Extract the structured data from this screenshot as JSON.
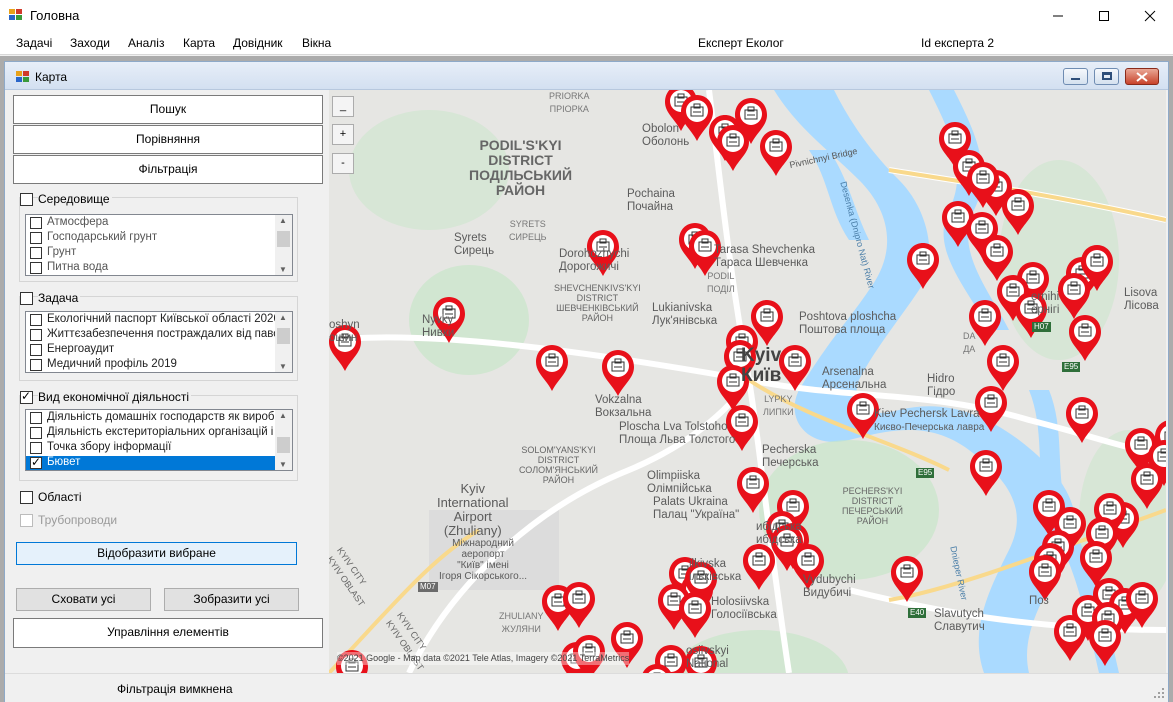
{
  "window": {
    "title": "Головна"
  },
  "menu": {
    "items": [
      "Задачі",
      "Заходи",
      "Аналіз",
      "Карта",
      "Довідник",
      "Вікна"
    ],
    "role_label": "Експерт Еколог",
    "expert_id_label": "Id експерта 2"
  },
  "child_window": {
    "title": "Карта"
  },
  "sidebar": {
    "buttons": {
      "search": "Пошук",
      "compare": "Порівняння",
      "filter": "Фільтрація"
    },
    "groups": [
      {
        "label": "Середовище",
        "checked": false,
        "items": [
          {
            "label": "Атмосфера",
            "checked": false
          },
          {
            "label": "Господарський грунт",
            "checked": false
          },
          {
            "label": "Грунт",
            "checked": false
          },
          {
            "label": "Питна вода",
            "checked": false
          }
        ]
      },
      {
        "label": "Задача",
        "checked": false,
        "items": [
          {
            "label": "Екологічний паспорт Київської області 2020",
            "checked": false
          },
          {
            "label": "Життєзабезпечення постраждалих від паводків",
            "checked": false
          },
          {
            "label": "Енергоаудит",
            "checked": false
          },
          {
            "label": "Медичний профіль 2019",
            "checked": false
          }
        ]
      },
      {
        "label": "Вид економічної діяльності",
        "checked": true,
        "items": [
          {
            "label": "Діяльність домашніх господарств як виробників",
            "checked": false
          },
          {
            "label": "Діяльність екстериторіальних організацій і органів",
            "checked": false
          },
          {
            "label": "Точка збору інформації",
            "checked": false
          },
          {
            "label": "Бювет",
            "checked": true,
            "selected": true
          }
        ]
      }
    ],
    "regions": {
      "label": "Області",
      "checked": false
    },
    "pipelines": {
      "label": "Трубопроводи",
      "checked": false,
      "disabled": true
    },
    "show_selected": "Відобразити вибране",
    "hide_all": "Сховати усі",
    "show_all": "Зобразити усі",
    "manage": "Управління елементів"
  },
  "map": {
    "zoom_buttons": [
      "_",
      "+",
      "-"
    ],
    "labels": {
      "obolon": "Obolon",
      "obolon_ua": "Оболонь",
      "priorka": "PRIORKA",
      "priorka_ua": "ПРІОРКА",
      "podilskyi_1": "PODIL'S'KYI",
      "podilskyi_2": "DISTRICT",
      "podilskyi_3": "ПОДІЛЬСЬКИЙ",
      "podilskyi_4": "РАЙОН",
      "pivnichnyi": "Pivnichnyi Bridge",
      "pochaina": "Pochaina",
      "pochaina_ua": "Почайна",
      "syrets_district_1": "SYRETS",
      "syrets_district_2": "СИРЕЦЬ",
      "syrets": "Syrets",
      "syrets_ua": "Сирець",
      "dorohozhychi": "Dorohozhychi",
      "dorohozhychi_ua": "Дорогожичі",
      "tarasa": "Tarasa Shevchenka",
      "tarasa_ua": "Тараса Шевченка",
      "podil": "PODIL",
      "podil_ua": "ПОДІЛ",
      "shevchenk_1": "SHEVCHENKIVS'KYI",
      "shevchenk_2": "DISTRICT",
      "shevchenk_3": "ШЕВЧЕНКІВСЬКИЙ",
      "shevchenk_4": "РАЙОН",
      "nyvky": "Nyvky",
      "nyvky_ua": "Нивки",
      "shyn": "oshyn",
      "shyn_ua": "ошин",
      "lukianivska": "Lukianivska",
      "lukianivska_ua": "Лук'янівська",
      "poshtova": "Poshtova ploshcha",
      "poshtova_ua": "Поштова площа",
      "kyiv": "Kyiv",
      "kyiv_ua": "Київ",
      "arsenalna": "Arsenalna",
      "arsenalna_ua": "Арсенальна",
      "hidro": "Hidro",
      "hidro_ua": "Гідро",
      "lypky": "LYPKY",
      "lypky_ua": "ЛИПКИ",
      "vokzalna": "Vokzalna",
      "vokzalna_ua": "Вокзальна",
      "ploscha_tolstoho": "Ploscha Lva Tolstoho",
      "ploscha_tolstoho_ua": "Площа Льва Толстого",
      "lavra": "Kiev Pechersk Lavra",
      "lavra_ua": "Києво-Печерська лавра",
      "solom_1": "SOLOM'YANS'KYI",
      "solom_2": "DISTRICT",
      "solom_3": "СОЛОМ'ЯНСЬКИЙ",
      "solom_4": "РАЙОН",
      "pecherska": "Pecherska",
      "pecherska_ua": "Печерська",
      "olimpiiska": "Olimpiiska",
      "olimpiiska_ua": "Олімпійська",
      "palats": "Palats Ukraina",
      "palats_ua": "Палац \"Україна\"",
      "airport_1": "Kyiv",
      "airport_2": "International",
      "airport_3": "Airport",
      "airport_4": "(Zhuliany)",
      "airport_5": "Міжнародний",
      "airport_6": "аеропорт",
      "airport_7": "\"Київ\" імені",
      "airport_8": "Ігоря Сікорського...",
      "pech_1": "PECHERS'KYI",
      "pech_2": "DISTRICT",
      "pech_3": "ПЕЧЕРСЬКИЙ",
      "pech_4": "РАЙОН",
      "lybidska_part": "ибідська",
      "lybidska_part_ua": "ибідська",
      "vydubychi": "Vydubychi",
      "vydubychi_ua": "Видубичі",
      "holosiivska": "Holosiivska",
      "holosiivska_ua": "Голосіївська",
      "vasylkivska": "ilkivska",
      "vasylkivska_ua": "ільківська",
      "slavutych": "Slavutych",
      "slavutych_ua": "Славутич",
      "lisova": "Lisova",
      "lisova_ua": "Лісова",
      "chernihivska": "ernihi",
      "chernihivska_ua": "ернігі",
      "darnytsia": "DA",
      "darnytsia_ua": "ДА",
      "pozniaky": "Поз",
      "zhuliany_1": "ZHULIANY",
      "zhuliany_2": "ЖУЛЯНИ",
      "holosiiv_1": "osiivskyi",
      "holosiiv_2": "National",
      "kyiv_oblast_1": "KYIV CITY",
      "kyiv_oblast_2": "KYIV OBLAST",
      "dnipro_river": "Dnieper River",
      "desenka": "Desenka (Dnipro Nat) River",
      "road_m07": "M07",
      "road_h07": "H07",
      "road_e95a": "E95",
      "road_e95b": "E95",
      "road_e40": "E40",
      "attribution": "©2021 Google - Map data ©2021 Tele Atlas, Imagery ©2021 TerraMetrics"
    },
    "marker_count": 85
  },
  "status": {
    "text": "Фільтрація вимкнена"
  }
}
